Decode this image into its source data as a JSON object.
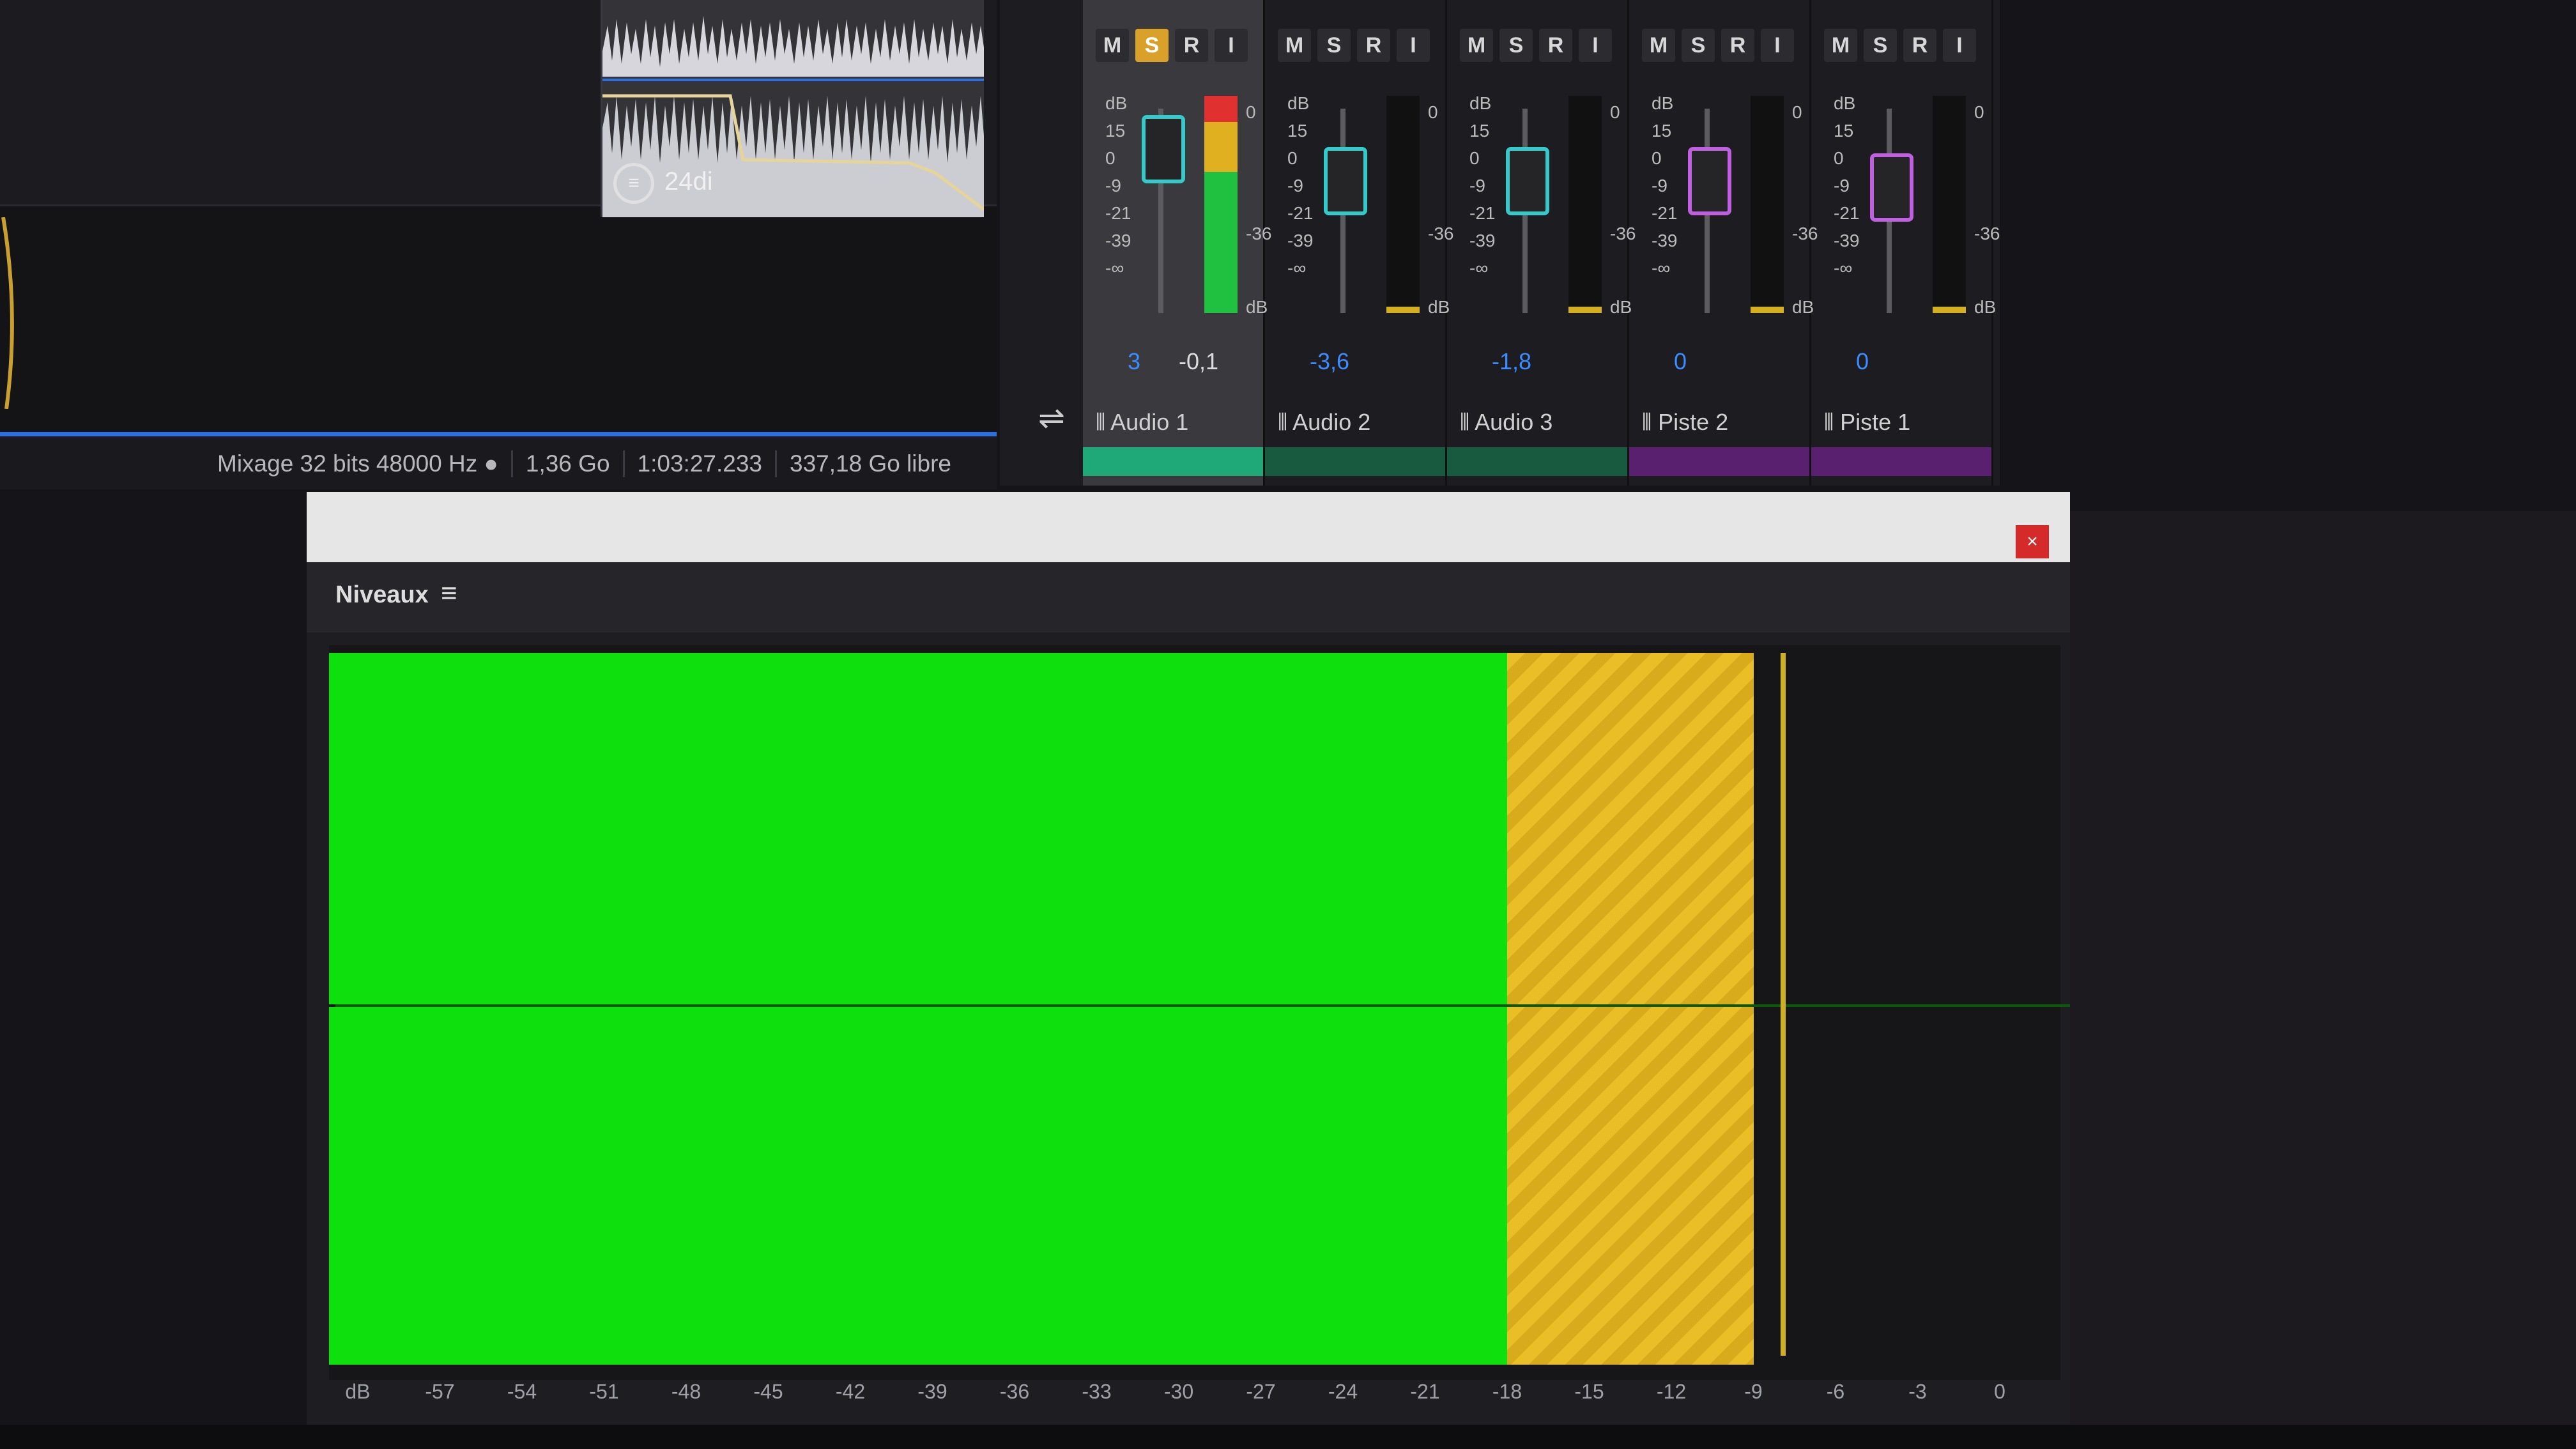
{
  "status_bar": {
    "mix": "Mixage 32 bits 48000 Hz ●",
    "size": "1,36 Go",
    "duration": "1:03:27.233",
    "free": "337,18 Go libre"
  },
  "clip": {
    "badge": "≡",
    "label": "24di"
  },
  "mixer": {
    "buttons": {
      "mute": "M",
      "solo": "S",
      "read": "R",
      "input": "I"
    },
    "channels": [
      {
        "name": "Audio 1",
        "value": "3",
        "meter_value": "-0,1",
        "color": "#1fa878",
        "fader_color": "#35c9c9"
      },
      {
        "name": "Audio 2",
        "value": "-3,6",
        "color": "#175a40",
        "fader_color": "#35c9c9"
      },
      {
        "name": "Audio 3",
        "value": "-1,8",
        "color": "#175a40",
        "fader_color": "#35c9c9"
      },
      {
        "name": "Piste 2",
        "value": "0",
        "color": "#5a2070",
        "fader_color": "#c060e0"
      },
      {
        "name": "Piste 1",
        "value": "0",
        "color": "#5a2070",
        "fader_color": "#c060e0"
      }
    ],
    "scale_labels": [
      "dB",
      "15",
      "0",
      "-9",
      "-21",
      "-39",
      "-∞"
    ],
    "meter_labels": {
      "top": "0",
      "mid": "-36",
      "unit": "dB"
    }
  },
  "levels": {
    "title": "Niveaux",
    "menu_icon": "hamburger-menu-icon",
    "close_icon": "close-icon",
    "close_label": "×",
    "level_db": -9,
    "peak_db": -8,
    "green_until_db": -18,
    "scale_ticks": [
      "dB",
      "-57",
      "-54",
      "-51",
      "-48",
      "-45",
      "-42",
      "-39",
      "-36",
      "-33",
      "-30",
      "-27",
      "-24",
      "-21",
      "-18",
      "-15",
      "-12",
      "-9",
      "-6",
      "-3",
      "0"
    ],
    "colors": {
      "green": "#0ee00e",
      "yellow": "#e9be27"
    }
  }
}
